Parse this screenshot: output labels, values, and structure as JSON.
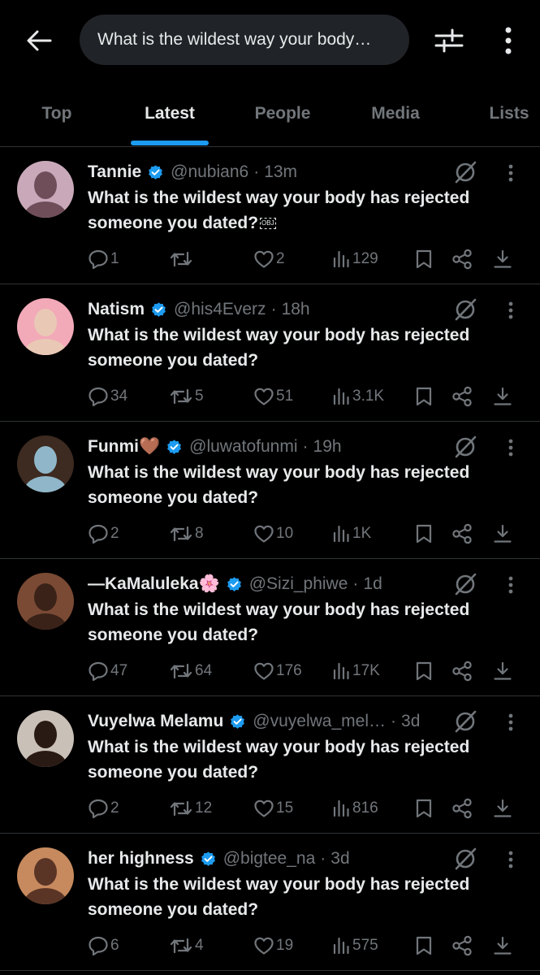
{
  "search": {
    "query": "What is the wildest way your body…"
  },
  "tabs": [
    {
      "label": "Top"
    },
    {
      "label": "Latest"
    },
    {
      "label": "People"
    },
    {
      "label": "Media"
    },
    {
      "label": "Lists"
    }
  ],
  "active_tab": "Latest",
  "colors": {
    "background": "#000000",
    "accent": "#1d9bf0",
    "muted": "#71767b",
    "text": "#e7e9ea",
    "divider": "#2f3336"
  },
  "icons": [
    "back-arrow-icon",
    "filter-sliders-icon",
    "more-vertical-icon",
    "verified-badge-icon",
    "grok-icon",
    "caret-icon",
    "reply-icon",
    "retweet-icon",
    "like-icon",
    "views-icon",
    "bookmark-icon",
    "share-icon",
    "download-icon"
  ],
  "tweets": [
    {
      "name": "Tannie",
      "handle": "@nubian6",
      "time": "13m",
      "text_line1": "What is the wildest way your body has rejected",
      "text_line2": "someone you dated?",
      "text_glyph": "OBJ",
      "replies": "1",
      "retweets": "",
      "likes": "2",
      "views": "129",
      "avatar_colors": [
        "#6f4e5a",
        "#c9a9b9"
      ]
    },
    {
      "name": "Natism",
      "handle": "@his4Everz",
      "time": "18h",
      "text_line1": "What is the wildest way your body has rejected",
      "text_line2": "someone you dated?",
      "replies": "34",
      "retweets": "5",
      "likes": "51",
      "views": "3.1K",
      "avatar_colors": [
        "#e9c9b5",
        "#f2a9b8"
      ]
    },
    {
      "name": "Funmi🤎",
      "handle": "@luwatofunmi",
      "time": "19h",
      "text_line1": "What is the wildest way your body has rejected",
      "text_line2": "someone you dated?",
      "replies": "2",
      "retweets": "8",
      "likes": "10",
      "views": "1K",
      "avatar_colors": [
        "#8fb7c9",
        "#3d2a20"
      ]
    },
    {
      "name": "—KaMaluleka🌸",
      "handle": "@Sizi_phiwe",
      "time": "1d",
      "text_line1": "What is the wildest way your body has rejected",
      "text_line2": "someone you dated?",
      "replies": "47",
      "retweets": "64",
      "likes": "176",
      "views": "17K",
      "avatar_colors": [
        "#3a2218",
        "#7a4a34"
      ]
    },
    {
      "name": "Vuyelwa Melamu",
      "handle": "@vuyelwa_mel…",
      "time": "3d",
      "text_line1": "What is the wildest way your body has rejected",
      "text_line2": "someone you dated?",
      "replies": "2",
      "retweets": "12",
      "likes": "15",
      "views": "816",
      "avatar_colors": [
        "#2a1a14",
        "#c9c0b8"
      ]
    },
    {
      "name": "her highness",
      "handle": "@bigtee_na",
      "time": "3d",
      "text_line1": "What is the wildest way your body has rejected",
      "text_line2": "someone you dated?",
      "replies": "6",
      "retweets": "4",
      "likes": "19",
      "views": "575",
      "avatar_colors": [
        "#5a3526",
        "#c78a5e"
      ]
    }
  ]
}
